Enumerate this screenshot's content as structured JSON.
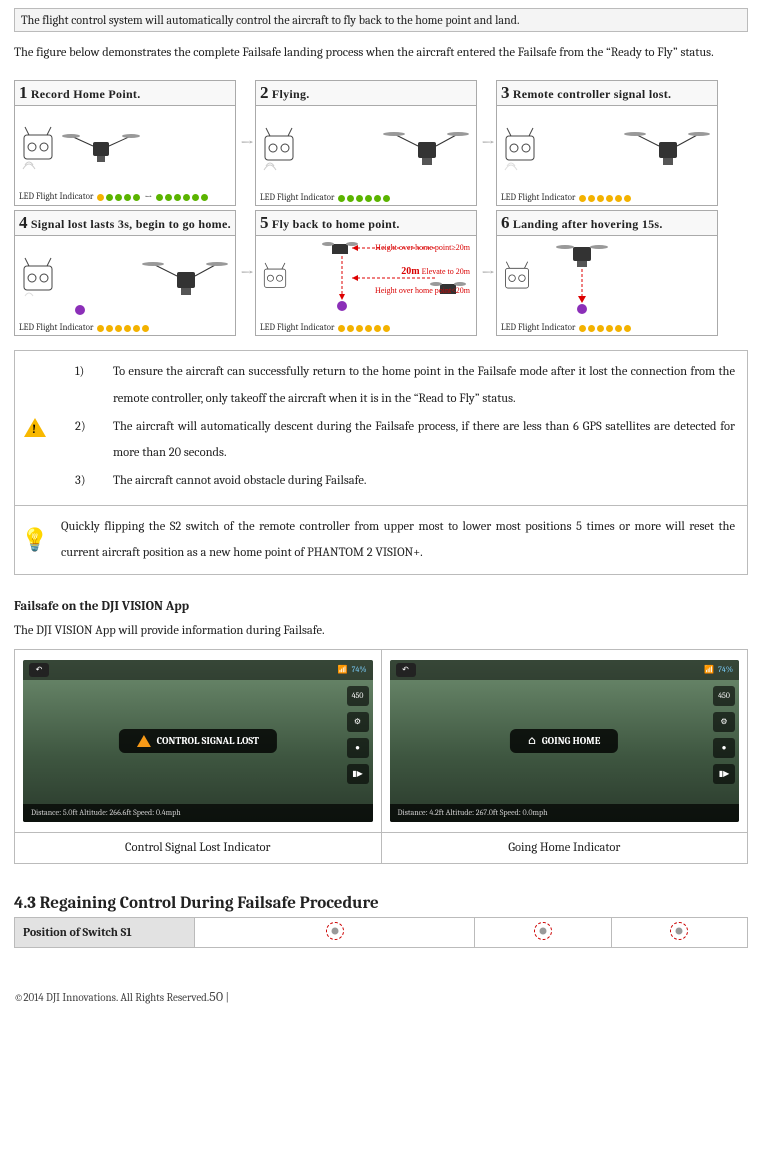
{
  "topnote": "The flight control system will automatically control the aircraft to fly back to the home point and land.",
  "intro": "The figure below demonstrates the complete Failsafe landing process when the aircraft entered the Failsafe from the “Ready to Fly” status.",
  "steps": {
    "t1": "Record Home Point.",
    "t2": "Flying.",
    "t3": "Remote controller signal lost.",
    "t4": "Signal lost lasts 3s, begin to go home.",
    "t5": "Fly back to home point.",
    "t6": "Landing after hovering 15s.",
    "led_label": "LED Flight Indicator",
    "step5_label_a": "Height over home point≥20m",
    "step5_label_b": "20m",
    "step5_label_c": "Elevate to 20m",
    "step5_label_d": "Height over home point<20m"
  },
  "notice": {
    "warn1": "To ensure the aircraft can successfully return to the home point in the Failsafe mode after it lost the connection from the remote controller, only takeoff the aircraft when it is in the “Read to Fly” status.",
    "warn2": "The aircraft will automatically descent during the Failsafe process, if there are less than 6 GPS satellites are detected for more than 20 seconds.",
    "warn3": "The aircraft cannot avoid obstacle during Failsafe.",
    "tip": "Quickly flipping the S2 switch of the remote controller from upper most to lower most positions 5 times or more will reset the current aircraft position as a new home point of PHANTOM 2 VISION+."
  },
  "subheading": "Failsafe on the DJI VISION App",
  "app_intro": "The DJI VISION App will provide information during Failsafe.",
  "app": {
    "badge_lost": "CONTROL SIGNAL LOST",
    "badge_home": "GOING HOME",
    "status_a": "Distance: 5.0ft  Altitude: 266.6ft  Speed: 0.4mph",
    "status_b": "Distance: 4.2ft  Altitude: 267.0ft  Speed: 0.0mph",
    "topbar_val": "450",
    "battery": "74%",
    "caption_a": "Control Signal Lost Indicator",
    "caption_b": "Going Home Indicator"
  },
  "section_heading": "4.3 Regaining Control During Failsafe Procedure",
  "s1_label": "Position of Switch S1",
  "footer_text": "©2014 DJI Innovations. All Rights Reserved.",
  "page_no": "50"
}
